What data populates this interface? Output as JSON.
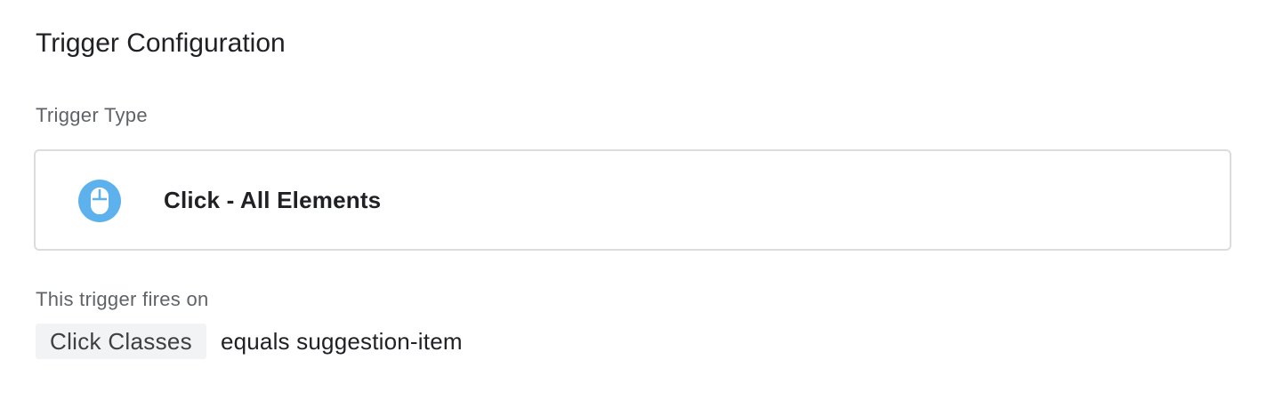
{
  "section": {
    "title": "Trigger Configuration"
  },
  "trigger_type": {
    "label": "Trigger Type",
    "name": "Click - All Elements",
    "icon": "mouse-icon",
    "icon_color": "#5db1ec"
  },
  "firing": {
    "label": "This trigger fires on",
    "variable": "Click Classes",
    "condition": "equals suggestion-item"
  }
}
